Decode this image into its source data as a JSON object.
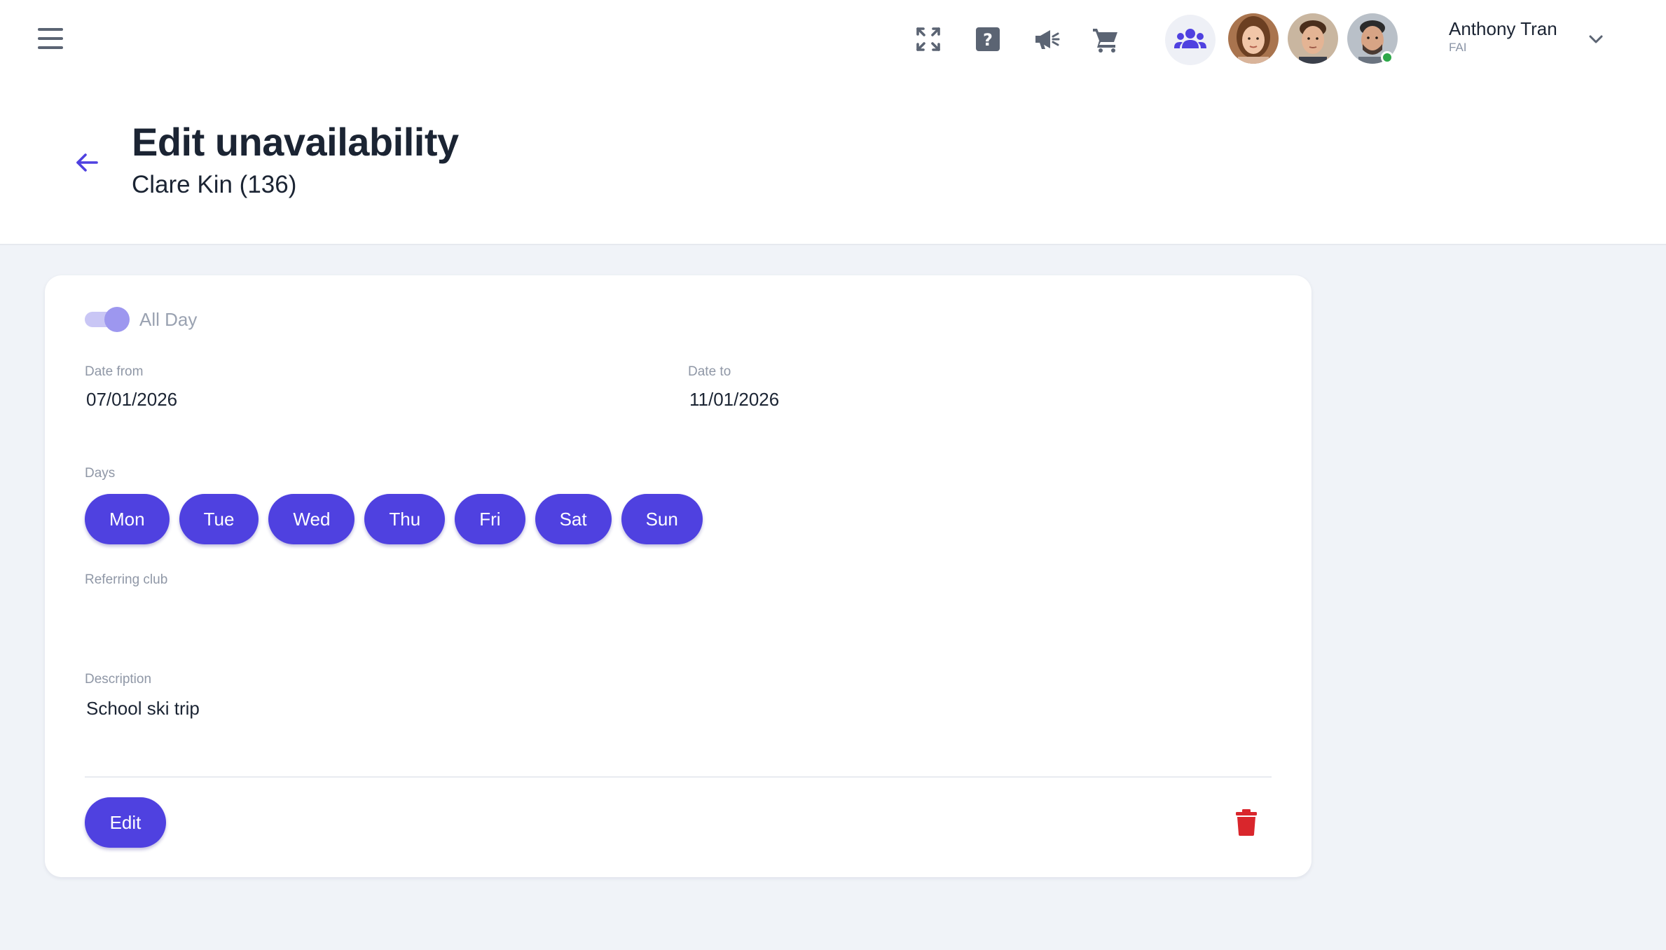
{
  "topbar": {
    "icons": [
      "menu-icon",
      "fullscreen-icon",
      "help-icon",
      "announcement-icon",
      "cart-icon",
      "team-icon"
    ],
    "user": {
      "name": "Anthony Tran",
      "org": "FAI"
    }
  },
  "header": {
    "title": "Edit unavailability",
    "subtitle": "Clare Kin (136)"
  },
  "form": {
    "all_day_label": "All Day",
    "all_day_on": true,
    "date_from": {
      "label": "Date from",
      "value": "07/01/2026"
    },
    "date_to": {
      "label": "Date to",
      "value": "11/01/2026"
    },
    "days_label": "Days",
    "days": [
      "Mon",
      "Tue",
      "Wed",
      "Thu",
      "Fri",
      "Sat",
      "Sun"
    ],
    "referring_club": {
      "label": "Referring club",
      "value": ""
    },
    "description": {
      "label": "Description",
      "value": "School ski trip"
    },
    "edit_label": "Edit"
  },
  "colors": {
    "primary": "#4f41e0",
    "danger": "#d9262c",
    "online": "#2ea84a",
    "background": "#f0f3f8"
  }
}
